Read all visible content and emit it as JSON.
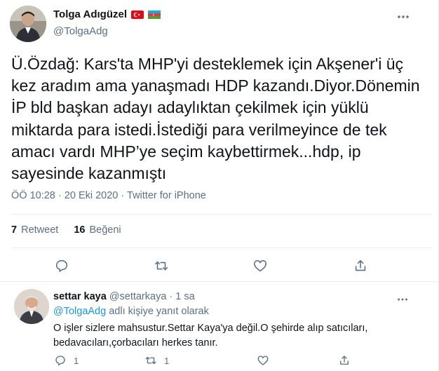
{
  "tweet": {
    "author_name": "Tolga Adıgüzel",
    "author_handle": "@TolgaAdg",
    "text": "Ü.Özdağ: Kars'ta MHP'yi desteklemek için Akşener'i üç\nkez aradım ama yanaşmadı HDP kazandı.Diyor.Dönemin\nİP bld başkan adayı adaylıktan çekilmek için yüklü\nmiktarda para istedi.İstediği para verilmeyince de tek\namacı vardı MHP’ye seçim kaybettirmek...hdp, ip\nsayesinde kazanmıştı",
    "time": "ÖÖ 10:28",
    "separator": "·",
    "date": "20 Eki 2020",
    "source": "Twitter for iPhone",
    "retweet_count": "7",
    "retweet_label": "Retweet",
    "like_count": "16",
    "like_label": "Beğeni",
    "flags": [
      "turkey-flag-icon",
      "azerbaijan-flag-icon"
    ]
  },
  "actions": {
    "icons": [
      "reply-icon",
      "retweet-icon",
      "like-icon",
      "share-icon"
    ]
  },
  "reply": {
    "author_name": "settar kaya",
    "author_handle": "@settarkaya",
    "separator": "·",
    "time": "1 sa",
    "replying_prefix": "@TolgaAdg",
    "replying_suffix": "adlı kişiye yanıt olarak",
    "text": "O işler sizlere mahsustur.Settar Kaya'ya değil.O şehirde alıp satıcıları,\nbedavacıları,çorbacıları herkes tanır.",
    "reply_count": "1",
    "retweet_count": "1",
    "like_count": "",
    "share_count": ""
  },
  "colors": {
    "text": "#0f1419",
    "secondary": "#5b7083",
    "link": "#1b95e0",
    "divider": "#e6ecf0"
  }
}
